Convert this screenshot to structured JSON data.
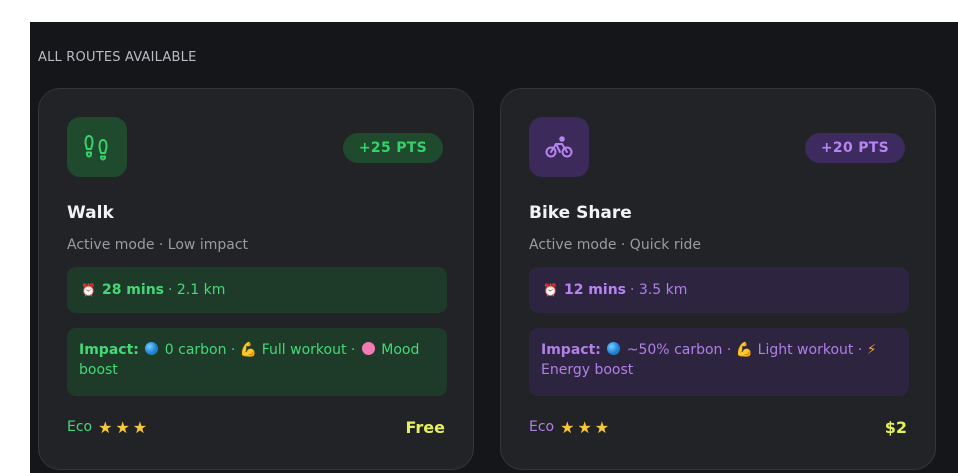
{
  "section": {
    "label": "ALL ROUTES AVAILABLE"
  },
  "cards": [
    {
      "id": "walk",
      "icon": "footprints-icon",
      "points": "+25 PTS",
      "title": "Walk",
      "subtitle": "Active mode · Low impact",
      "time": "28 mins",
      "distance": "· 2.1 km",
      "impact_label": "Impact:",
      "impact_parts": [
        "0 carbon ·",
        "Full workout ·",
        "Mood boost"
      ],
      "eco_label": "Eco",
      "stars": "★★★",
      "price": "Free"
    },
    {
      "id": "bike",
      "icon": "bicycle-icon",
      "points": "+20 PTS",
      "title": "Bike Share",
      "subtitle": "Active mode · Quick ride",
      "time": "12 mins",
      "distance": "· 3.5 km",
      "impact_label": "Impact:",
      "impact_parts": [
        "~50% carbon ·",
        "Light workout ·",
        "Energy boost"
      ],
      "eco_label": "Eco",
      "stars": "★★★",
      "price": "$2"
    }
  ],
  "colors": {
    "background": "#14161a",
    "card": "#222327",
    "walk_accent": "#34d36a",
    "bike_accent": "#b784f2",
    "price": "#e6f05a",
    "star": "#f7c73a"
  }
}
